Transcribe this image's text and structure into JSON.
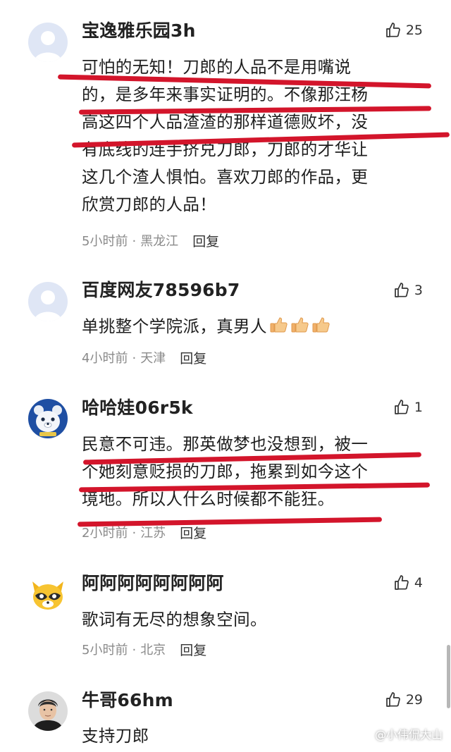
{
  "comments": [
    {
      "username": "宝逸雅乐园3h",
      "likes": "25",
      "text_lines": [
        "可怕的无知！刀郎的人品不是用嘴说",
        "的，是多年来事实证明的。不像那汪杨",
        "高这四个人品渣渣的那样道德败坏，没",
        "有底线的连手挤兑刀郎，刀郎的才华让",
        "这几个渣人惧怕。喜欢刀郎的作品，更",
        "欣赏刀郎的人品！"
      ],
      "time": "5小时前",
      "location": "黑龙江",
      "reply": "回复",
      "avatar": "default-avatar"
    },
    {
      "username": "百度网友78596b7",
      "likes": "3",
      "text_lines": [
        "单挑整个学院派，真男人"
      ],
      "emoji": [
        "thumbs-up-emoji",
        "thumbs-up-emoji",
        "thumbs-up-emoji"
      ],
      "time": "4小时前",
      "location": "天津",
      "reply": "回复",
      "avatar": "default-avatar"
    },
    {
      "username": "哈哈娃06r5k",
      "likes": "1",
      "text_lines": [
        "民意不可违。那英做梦也没想到，被一",
        "个她刻意贬损的刀郎，拖累到如今这个",
        "境地。所以人什么时候都不能狂。"
      ],
      "time": "2小时前",
      "location": "江苏",
      "reply": "回复",
      "avatar": "bear-avatar"
    },
    {
      "username": "阿阿阿阿阿阿阿阿",
      "likes": "4",
      "text_lines": [
        "歌词有无尽的想象空间。"
      ],
      "time": "5小时前",
      "location": "北京",
      "reply": "回复",
      "avatar": "raccoon-avatar"
    },
    {
      "username": "牛哥66hm",
      "likes": "29",
      "text_lines": [
        "支持刀郎"
      ],
      "avatar": "photo-avatar"
    }
  ],
  "watermark": "@小伟侃大山",
  "colors": {
    "underline": "#d3152b",
    "meta": "#8a8a8a",
    "text": "#1d1d1d"
  },
  "icons": {
    "like": "thumbs-up-outline-icon"
  }
}
